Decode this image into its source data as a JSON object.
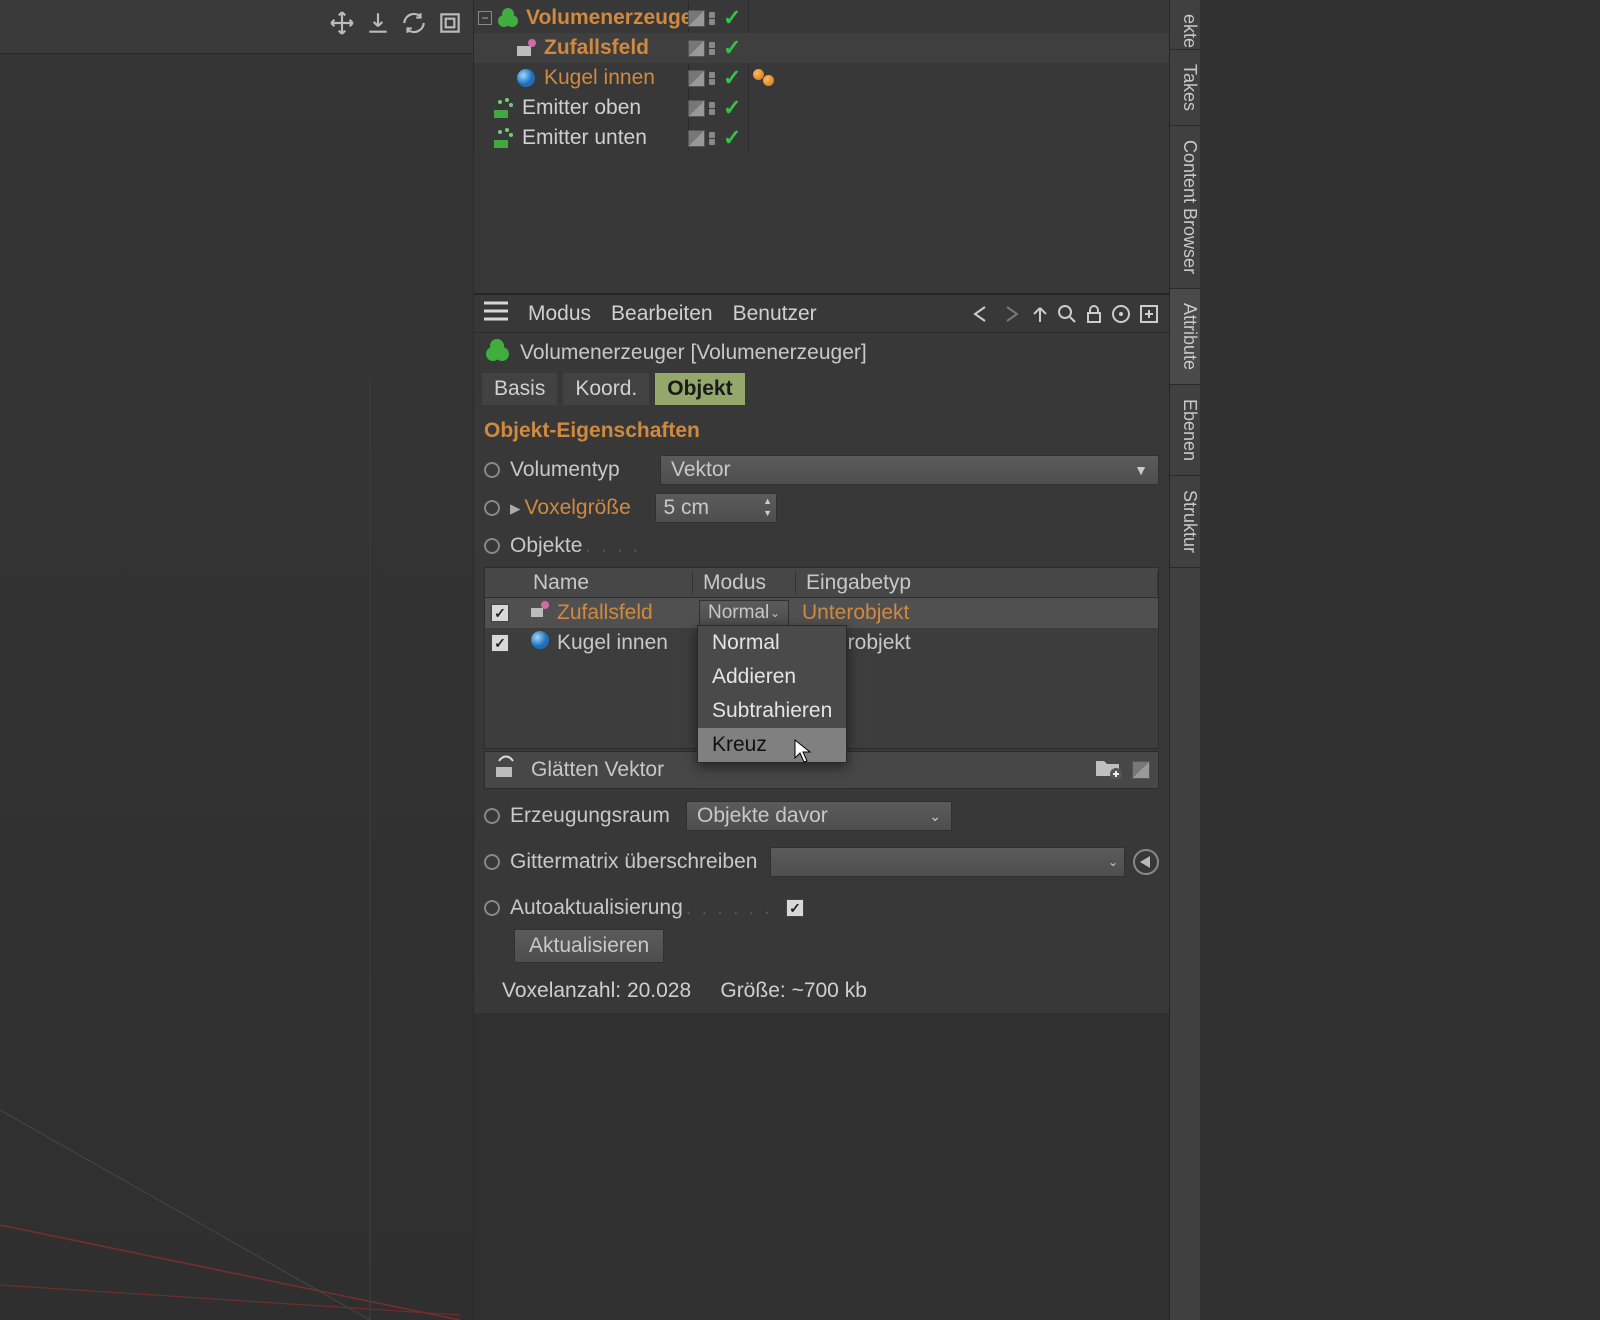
{
  "tree": {
    "items": [
      {
        "name": "Volumenerzeuger",
        "style": "bold-link"
      },
      {
        "name": "Zufallsfeld",
        "style": "bold-link"
      },
      {
        "name": "Kugel innen",
        "style": "link"
      },
      {
        "name": "Emitter oben",
        "style": "plain"
      },
      {
        "name": "Emitter unten",
        "style": "plain"
      }
    ]
  },
  "attr": {
    "menus": {
      "mode": "Modus",
      "edit": "Bearbeiten",
      "user": "Benutzer"
    },
    "title": "Volumenerzeuger [Volumenerzeuger]",
    "tabs": {
      "basis": "Basis",
      "koord": "Koord.",
      "objekt": "Objekt"
    },
    "section": "Objekt-Eigenschaften",
    "volumetype": {
      "label": "Volumentyp",
      "value": "Vektor"
    },
    "voxelsize": {
      "label": "Voxelgröße",
      "value": "5 cm"
    },
    "objects_label": "Objekte",
    "table": {
      "headers": {
        "name": "Name",
        "mode": "Modus",
        "type": "Eingabetyp"
      },
      "rows": [
        {
          "name": "Zufallsfeld",
          "mode": "Normal",
          "type": "Unterobjekt",
          "link": true
        },
        {
          "name": "Kugel innen",
          "mode": "",
          "type": "erobjekt",
          "link": false
        }
      ]
    },
    "popup": {
      "items": [
        "Normal",
        "Addieren",
        "Subtrahieren",
        "Kreuz"
      ],
      "hover": 3
    },
    "smooth": "Glätten Vektor",
    "genspace": {
      "label": "Erzeugungsraum",
      "value": "Objekte davor"
    },
    "override": "Gittermatrix überschreiben",
    "autoupdate": "Autoaktualisierung",
    "update_btn": "Aktualisieren",
    "footer": {
      "voxels_label": "Voxelanzahl:",
      "voxels": "20.028",
      "size_label": "Größe:",
      "size": "~700 kb"
    }
  },
  "side": {
    "t0": "ekte",
    "t1": "Takes",
    "t2": "Content Browser",
    "t3": "Attribute",
    "t4": "Ebenen",
    "t5": "Struktur"
  }
}
